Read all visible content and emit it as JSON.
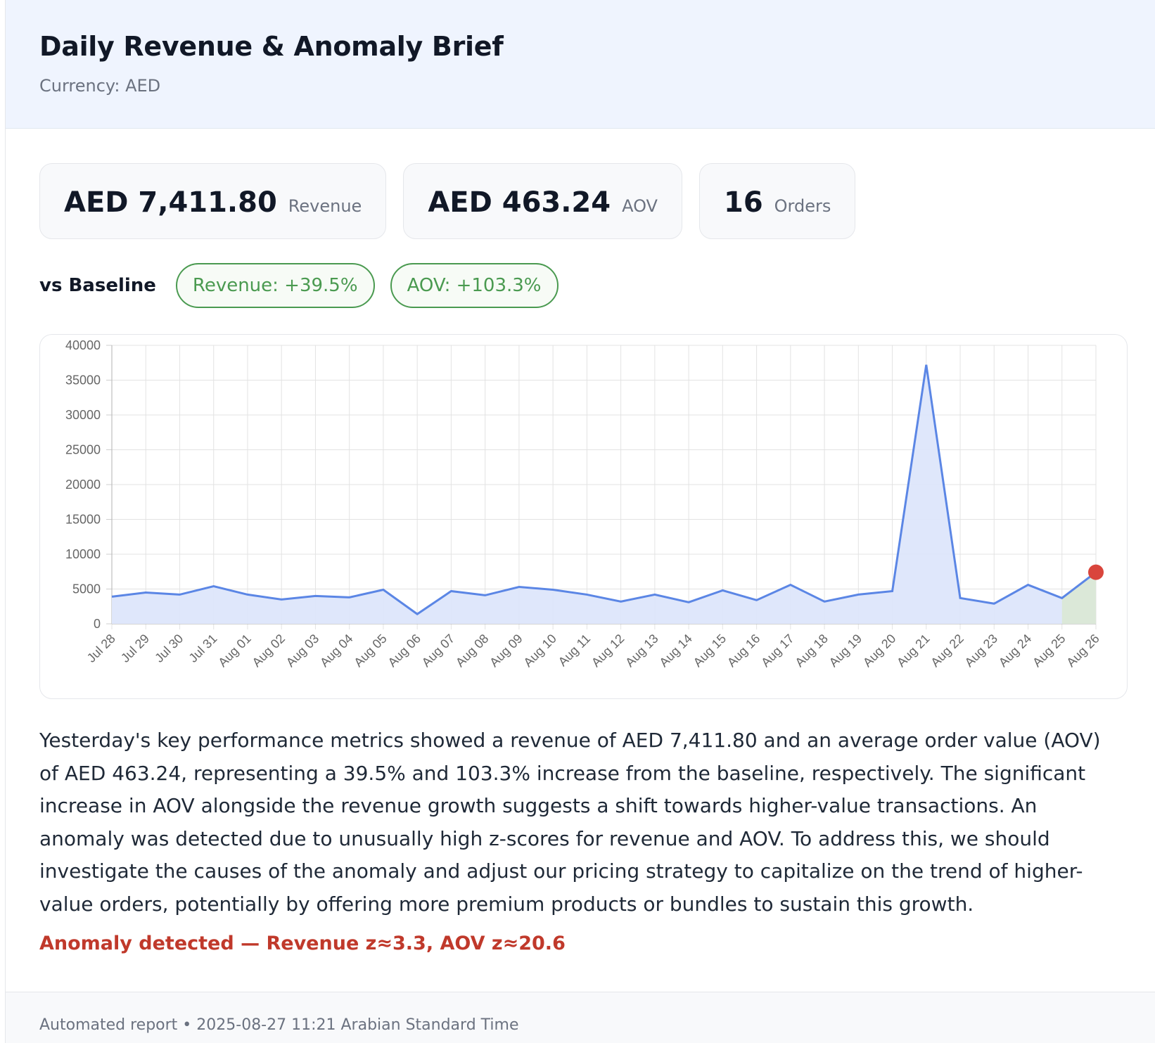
{
  "header": {
    "title": "Daily Revenue & Anomaly Brief",
    "currency": "Currency: AED"
  },
  "kpis": [
    {
      "value": "AED 7,411.80",
      "label": "Revenue"
    },
    {
      "value": "AED 463.24",
      "label": "AOV"
    },
    {
      "value": "16",
      "label": "Orders"
    }
  ],
  "baseline": {
    "label": "vs Baseline",
    "revenue_change": "Revenue: +39.5%",
    "aov_change": "AOV: +103.3%"
  },
  "colors": {
    "line": "#5b86e5",
    "fill": "#dde6fb",
    "highlight_fill": "#dbe8d8",
    "highlight_point": "#d9453c",
    "positive": "#4a9a50",
    "anomaly": "#c0392b"
  },
  "chart_data": {
    "type": "area",
    "categories": [
      "Jul 28",
      "Jul 29",
      "Jul 30",
      "Jul 31",
      "Aug 01",
      "Aug 02",
      "Aug 03",
      "Aug 04",
      "Aug 05",
      "Aug 06",
      "Aug 07",
      "Aug 08",
      "Aug 09",
      "Aug 10",
      "Aug 11",
      "Aug 12",
      "Aug 13",
      "Aug 14",
      "Aug 15",
      "Aug 16",
      "Aug 17",
      "Aug 18",
      "Aug 19",
      "Aug 20",
      "Aug 21",
      "Aug 22",
      "Aug 23",
      "Aug 24",
      "Aug 25",
      "Aug 26"
    ],
    "values": [
      3900,
      4500,
      4200,
      5400,
      4200,
      3500,
      4000,
      3800,
      4900,
      1400,
      4700,
      4100,
      5300,
      4900,
      4200,
      3200,
      4200,
      3100,
      4800,
      3400,
      5600,
      3200,
      4200,
      4700,
      37200,
      3700,
      2900,
      5600,
      3700,
      7411.8
    ],
    "ylim": [
      0,
      40000
    ],
    "yticks": [
      0,
      5000,
      10000,
      15000,
      20000,
      25000,
      30000,
      35000,
      40000
    ],
    "grid": true,
    "highlight_last": true
  },
  "narrative": "Yesterday's key performance metrics showed a revenue of AED 7,411.80 and an average order value (AOV) of AED 463.24, representing a 39.5% and 103.3% increase from the baseline, respectively. The significant increase in AOV alongside the revenue growth suggests a shift towards higher-value transactions. An anomaly was detected due to unusually high z-scores for revenue and AOV. To address this, we should investigate the causes of the anomaly and adjust our pricing strategy to capitalize on the trend of higher-value orders, potentially by offering more premium products or bundles to sustain this growth.",
  "anomaly": "Anomaly detected — Revenue z≈3.3, AOV z≈20.6",
  "footer": "Automated report • 2025-08-27 11:21 Arabian Standard Time"
}
